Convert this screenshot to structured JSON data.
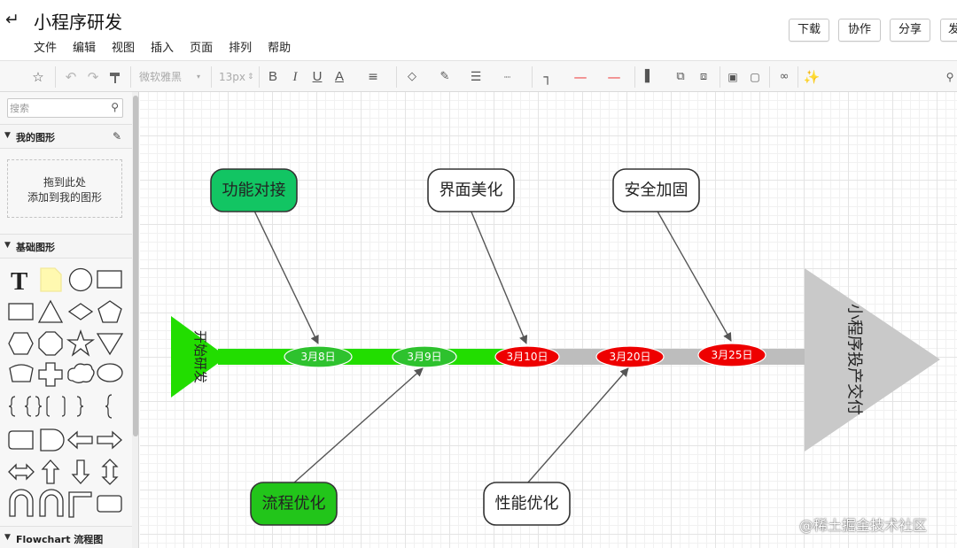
{
  "header": {
    "back_icon": "back-arrow-icon",
    "title": "小程序研发",
    "menu": [
      "文件",
      "编辑",
      "视图",
      "插入",
      "页面",
      "排列",
      "帮助"
    ],
    "buttons": {
      "download": "下载",
      "collaborate": "协作",
      "share": "分享",
      "publish": "发"
    }
  },
  "toolbar": {
    "font_family": "微软雅黑",
    "font_size": "13px",
    "icons": [
      "format-painter-clear-icon",
      "undo-icon",
      "redo-icon",
      "format-brush-icon",
      "bold-icon",
      "italic-icon",
      "underline-icon",
      "font-color-icon",
      "align-icon",
      "fill-color-icon",
      "line-color-icon",
      "line-width-icon",
      "line-style-icon",
      "connector-icon",
      "line-start-icon",
      "line-end-icon",
      "align-left-icon",
      "bring-front-icon",
      "send-back-icon",
      "lock-icon",
      "unlock-icon",
      "link-icon",
      "magic-wand-icon",
      "search-icon"
    ],
    "labels": {
      "bold": "B",
      "italic": "I",
      "underline": "U",
      "font_color": "A"
    }
  },
  "sidebar": {
    "search_placeholder": "搜索",
    "my_shapes": {
      "title": "我的图形",
      "drop_hint_line1": "拖到此处",
      "drop_hint_line2": "添加到我的图形"
    },
    "basic_shapes": {
      "title": "基础图形"
    },
    "flowchart": {
      "title": "Flowchart 流程图"
    }
  },
  "diagram": {
    "head_text": "开始研发",
    "tail_text": "小程序投产交付",
    "milestones": [
      {
        "text": "3月8日",
        "color": "#2ec22e"
      },
      {
        "text": "3月9日",
        "color": "#2ec22e"
      },
      {
        "text": "3月10日",
        "color": "#ee0000"
      },
      {
        "text": "3月20日",
        "color": "#ee0000"
      },
      {
        "text": "3月25日",
        "color": "#ee0000"
      }
    ],
    "tasks_top": [
      {
        "text": "功能对接",
        "fill": "#12c563"
      },
      {
        "text": "界面美化",
        "fill": "#ffffff"
      },
      {
        "text": "安全加固",
        "fill": "#ffffff"
      }
    ],
    "tasks_bottom": [
      {
        "text": "流程优化",
        "fill": "#22c51a"
      },
      {
        "text": "性能优化",
        "fill": "#ffffff"
      }
    ],
    "colors": {
      "spine_done": "#22dd00",
      "spine_todo": "#bdbdbd",
      "head": "#22dd00",
      "tail": "#c9c9c9"
    }
  },
  "watermark": "@稀土掘金技术社区"
}
